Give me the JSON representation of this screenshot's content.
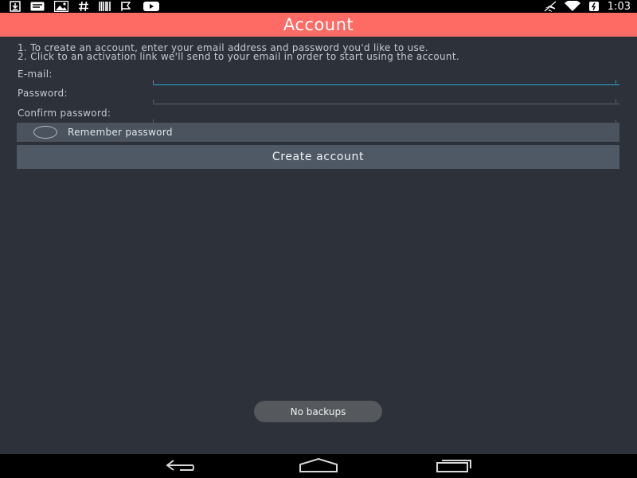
{
  "status_bar": {
    "time": "1:03",
    "left_icons": [
      "download-icon",
      "message-icon",
      "gallery-icon",
      "hash-icon",
      "barcode-icon",
      "flag-icon",
      "youtube-icon"
    ],
    "right_icons": [
      "airplane-mode-icon",
      "wifi-icon",
      "battery-charging-icon"
    ]
  },
  "action_bar": {
    "title": "Account"
  },
  "instructions": {
    "line1": "1. To create an account, enter your email address and password you'd like to use.",
    "line2": "2. Click to an activation link we'll send to your email in order to start using the account."
  },
  "form": {
    "email_label": "E-mail:",
    "email_value": "",
    "password_label": "Password:",
    "password_value": "",
    "confirm_label": "Confirm password:",
    "confirm_value": ""
  },
  "remember": {
    "label": "Remember password",
    "checked": false
  },
  "create_button": {
    "label": "Create account"
  },
  "toast": {
    "text": "No backups"
  },
  "nav_bar": {
    "icons": [
      "back-icon",
      "home-icon",
      "recents-icon"
    ]
  },
  "colors": {
    "accent": "#fe6a64",
    "background": "#2c313a",
    "focus_line": "#2fa7d9",
    "button_bg": "#4f5965"
  }
}
